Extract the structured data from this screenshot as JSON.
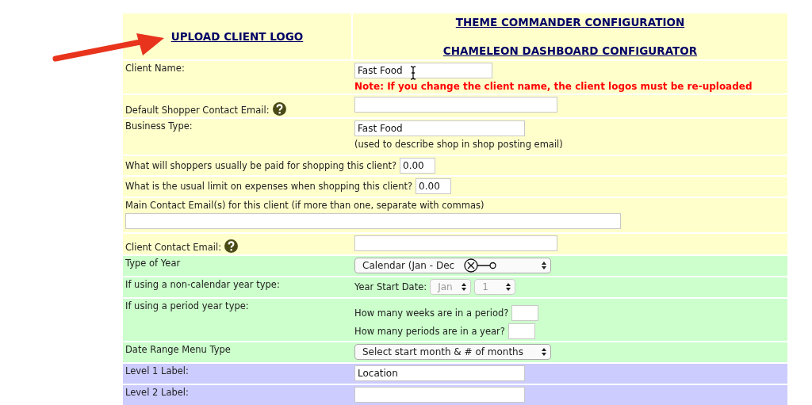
{
  "header": {
    "upload_link": "UPLOAD CLIENT LOGO",
    "links": [
      "THEME COMMANDER CONFIGURATION",
      "CHAMELEON DASHBOARD CONFIGURATOR"
    ]
  },
  "rows": [
    {
      "kind": "pair",
      "color": "#ffffcc",
      "label": "Client Name:",
      "lines": [
        [
          {
            "kind": "input",
            "value": "Fast Food",
            "text_cursor": true
          }
        ],
        [
          {
            "kind": "note",
            "text": "Note: If you change the client name, the client logos must be re-uploaded"
          }
        ]
      ]
    },
    {
      "kind": "pair",
      "color": "#ffffcc",
      "label": "Default Shopper Contact Email:",
      "help": true,
      "lines": [
        [
          {
            "kind": "input"
          }
        ]
      ]
    },
    {
      "kind": "pair",
      "color": "#ffffcc",
      "label": "Business Type:",
      "lines": [
        [
          {
            "kind": "input",
            "value": "Fast Food"
          }
        ],
        [
          {
            "kind": "hint",
            "text": "(used to describe shop in shop posting email)"
          }
        ]
      ]
    },
    {
      "kind": "inline",
      "color": "#ffffcc",
      "label": "What will shoppers usually be paid for shopping this client?",
      "lines": [
        [
          {
            "kind": "input",
            "value": "0.00"
          }
        ]
      ]
    },
    {
      "kind": "inline",
      "color": "#ffffcc",
      "label": "What is the usual limit on expenses when shopping this client?",
      "lines": [
        [
          {
            "kind": "input",
            "value": "0.00"
          }
        ]
      ]
    },
    {
      "kind": "wide",
      "color": "#ffffcc",
      "label": "Main Contact Email(s) for this client (if more than one, separate with commas)",
      "lines": [
        [
          {
            "kind": "input"
          }
        ]
      ]
    },
    {
      "kind": "pair",
      "color": "#ffffcc",
      "label": "Client Contact Email:",
      "help": true,
      "lines": [
        [
          {
            "kind": "input"
          }
        ]
      ]
    },
    {
      "kind": "pair",
      "color": "#ccffcc",
      "label": "Type of Year",
      "lines": [
        [
          {
            "kind": "select",
            "value": "Calendar (Jan - Dec",
            "disabled": false,
            "annotation_marker": true
          }
        ]
      ]
    },
    {
      "kind": "pair",
      "color": "#ccffcc",
      "label": "If using a non-calendar year type:",
      "lines": [
        [
          {
            "kind": "text",
            "text": "Year Start Date:"
          },
          {
            "kind": "select",
            "value": "Jan",
            "disabled": true
          },
          {
            "kind": "select",
            "value": "1",
            "disabled": true
          }
        ]
      ]
    },
    {
      "kind": "pair",
      "color": "#ccffcc",
      "label": "If using a period year type:",
      "lines": [
        [
          {
            "kind": "text",
            "text": "How many weeks are in a period?"
          },
          {
            "kind": "input"
          }
        ],
        [
          {
            "kind": "text",
            "text": "How many periods are in a year?"
          },
          {
            "kind": "input"
          }
        ]
      ]
    },
    {
      "kind": "pair",
      "color": "#ccffcc",
      "label": "Date Range Menu Type",
      "lines": [
        [
          {
            "kind": "select",
            "value": "Select start month & # of months",
            "disabled": false
          }
        ]
      ]
    },
    {
      "kind": "pair",
      "color": "#ccccff",
      "label": "Level 1 Label:",
      "lines": [
        [
          {
            "kind": "input",
            "value": "Location"
          }
        ]
      ]
    },
    {
      "kind": "pair",
      "color": "#ccccff",
      "label": "Level 2 Label:",
      "lines": [
        [
          {
            "kind": "input"
          }
        ]
      ]
    }
  ]
}
